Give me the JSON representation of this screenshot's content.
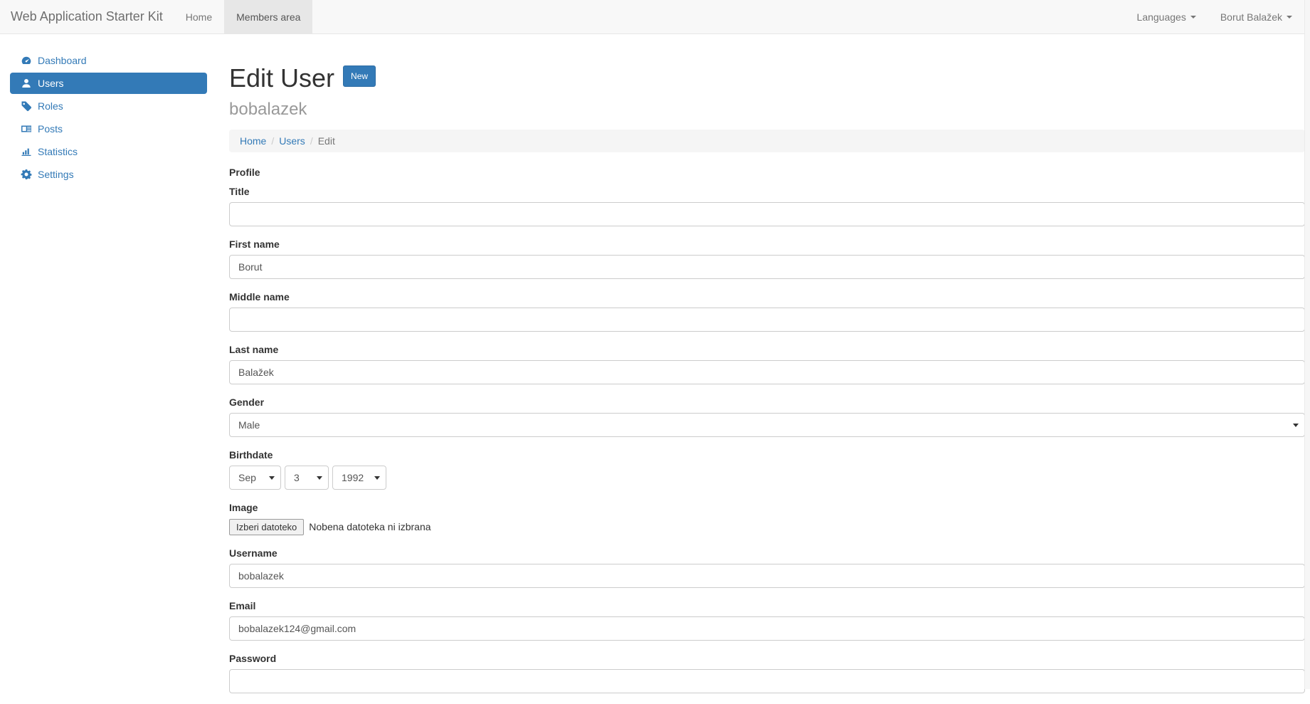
{
  "colors": {
    "accent": "#337ab7",
    "navbar_bg": "#f8f8f8",
    "navbar_border": "#e7e7e7",
    "active_tab_bg": "#e7e7e7",
    "breadcrumb_bg": "#f5f5f5"
  },
  "navbar": {
    "brand": "Web Application Starter Kit",
    "tabs": [
      {
        "label": "Home",
        "active": false
      },
      {
        "label": "Members area",
        "active": true
      }
    ],
    "right": [
      {
        "label": "Languages",
        "icon": "caret-down-icon"
      },
      {
        "label": "Borut Balažek",
        "icon": "caret-down-icon"
      }
    ]
  },
  "sidebar": {
    "items": [
      {
        "label": "Dashboard",
        "icon": "tachometer-icon",
        "active": false
      },
      {
        "label": "Users",
        "icon": "user-icon",
        "active": true
      },
      {
        "label": "Roles",
        "icon": "tag-icon",
        "active": false
      },
      {
        "label": "Posts",
        "icon": "newspaper-icon",
        "active": false
      },
      {
        "label": "Statistics",
        "icon": "bar-chart-icon",
        "active": false
      },
      {
        "label": "Settings",
        "icon": "gear-icon",
        "active": false
      }
    ]
  },
  "page": {
    "title": "Edit User",
    "new_button_label": "New",
    "subtitle": "bobalazek"
  },
  "breadcrumb": {
    "items": [
      "Home",
      "Users",
      "Edit"
    ]
  },
  "form": {
    "section_label": "Profile",
    "title": {
      "label": "Title",
      "value": ""
    },
    "first_name": {
      "label": "First name",
      "value": "Borut"
    },
    "middle_name": {
      "label": "Middle name",
      "value": ""
    },
    "last_name": {
      "label": "Last name",
      "value": "Balažek"
    },
    "gender": {
      "label": "Gender",
      "value": "Male"
    },
    "birthdate": {
      "label": "Birthdate",
      "month": "Sep",
      "day": "3",
      "year": "1992"
    },
    "image": {
      "label": "Image",
      "button_label": "Izberi datoteko",
      "status_text": "Nobena datoteka ni izbrana"
    },
    "username": {
      "label": "Username",
      "value": "bobalazek"
    },
    "email": {
      "label": "Email",
      "value": "bobalazek124@gmail.com"
    },
    "password": {
      "label": "Password",
      "value": ""
    }
  }
}
